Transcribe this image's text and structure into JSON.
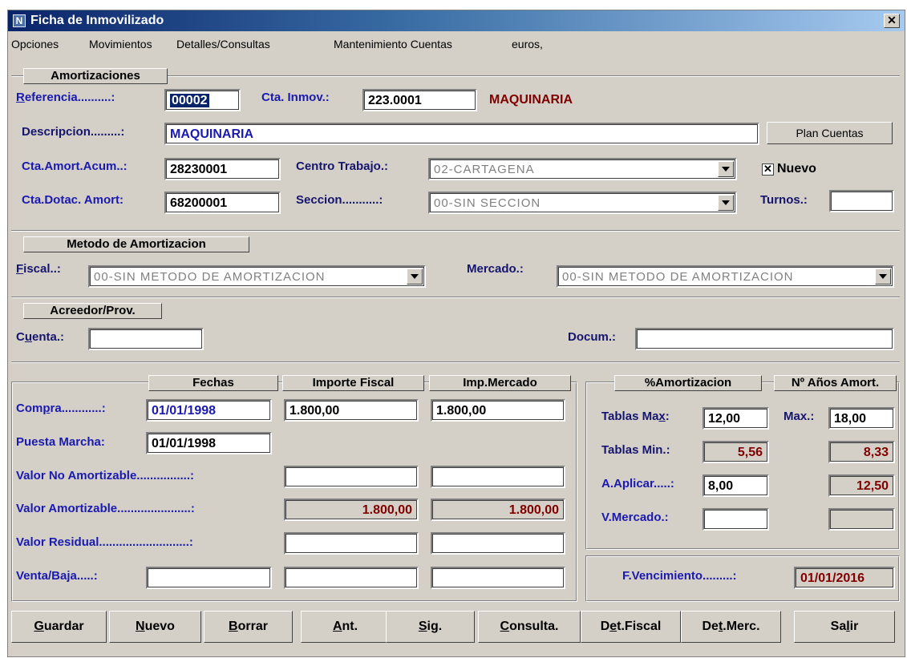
{
  "window": {
    "title": "Ficha de Inmovilizado",
    "close_glyph": "✕",
    "icon": "app-icon"
  },
  "menu": [
    "Opciones",
    "Movimientos",
    "Detalles/Consultas",
    "Mantenimiento Cuentas",
    "euros,"
  ],
  "amortizaciones": {
    "group_label": "Amortizaciones",
    "referencia_label": "Referencia..........:",
    "referencia_value": "00002",
    "cta_inmov_label": "Cta. Inmov.:",
    "cta_inmov_value": "223.0001",
    "cta_inmov_desc": "MAQUINARIA",
    "descripcion_label": "Descripcion.........:",
    "descripcion_value": "MAQUINARIA",
    "plan_cuentas_button": "Plan Cuentas",
    "cta_amort_label": "Cta.Amort.Acum..:",
    "cta_amort_value": "28230001",
    "centro_trabajo_label": "Centro Trabajo.:",
    "centro_trabajo_value": "02-CARTAGENA",
    "nuevo_label": "Nuevo",
    "nuevo_checked": true,
    "cta_dotac_label": "Cta.Dotac. Amort:",
    "cta_dotac_value": "68200001",
    "seccion_label": "Seccion...........:",
    "seccion_value": "00-SIN SECCION",
    "turnos_label": "Turnos.:",
    "turnos_value": ""
  },
  "metodo": {
    "group_label": "Metodo de Amortizacion",
    "fiscal_label": "Fiscal..:",
    "fiscal_value": "00-SIN METODO DE AMORTIZACION",
    "mercado_label": "Mercado.:",
    "mercado_value": "00-SIN METODO DE AMORTIZACION"
  },
  "acreedor": {
    "group_label": "Acreedor/Prov.",
    "cuenta_label": "Cuenta.:",
    "cuenta_value": "",
    "docum_label": "Docum.:",
    "docum_value": ""
  },
  "valores": {
    "fechas_header": "Fechas",
    "importe_fiscal_header": "Importe Fiscal",
    "imp_mercado_header": "Imp.Mercado",
    "compra_label": "Compra............:",
    "compra_fecha": "01/01/1998",
    "compra_fiscal": "1.800,00",
    "compra_mercado": "1.800,00",
    "puesta_marcha_label": "Puesta Marcha:",
    "puesta_marcha_fecha": "01/01/1998",
    "valor_no_amort_label": "Valor No Amortizable................:",
    "valor_no_amort_fiscal": "",
    "valor_no_amort_mercado": "",
    "valor_amort_label": "Valor Amortizable......................:",
    "valor_amort_fiscal": "1.800,00",
    "valor_amort_mercado": "1.800,00",
    "valor_residual_label": "Valor Residual...........................:",
    "valor_residual_fiscal": "",
    "valor_residual_mercado": "",
    "venta_baja_label": "Venta/Baja.....:",
    "venta_baja_fecha": "",
    "venta_baja_fiscal": "",
    "venta_baja_mercado": ""
  },
  "porcentajes": {
    "amortizacion_header": "%Amortizacion",
    "anos_header": "Nº Años Amort.",
    "tablas_max_label": "Tablas Max:",
    "tablas_max_value": "12,00",
    "max_label": "Max.:",
    "max_value": "18,00",
    "tablas_min_label": "Tablas Min.:",
    "tablas_min_value": "5,56",
    "min_anos_value": "8,33",
    "a_aplicar_label": "A.Aplicar.....:",
    "a_aplicar_value": "8,00",
    "a_aplicar_anos_value": "12,50",
    "v_mercado_label": "V.Mercado.:",
    "v_mercado_value": "",
    "v_mercado_anos_value": "",
    "f_vencimiento_label": "F.Vencimiento.........:",
    "f_vencimiento_value": "01/01/2016"
  },
  "buttons": {
    "guardar": "Guardar",
    "nuevo": "Nuevo",
    "borrar": "Borrar",
    "ant": "Ant.",
    "sig": "Sig.",
    "consulta": "Consulta.",
    "det_fiscal": "Det.Fiscal",
    "det_merc": "Det.Merc.",
    "salir": "Salir"
  },
  "colors": {
    "label_blue": "#1a1ab0",
    "value_maroon": "#800000",
    "title_gradient_start": "#0a246a",
    "window_face": "#d4d0c8"
  }
}
